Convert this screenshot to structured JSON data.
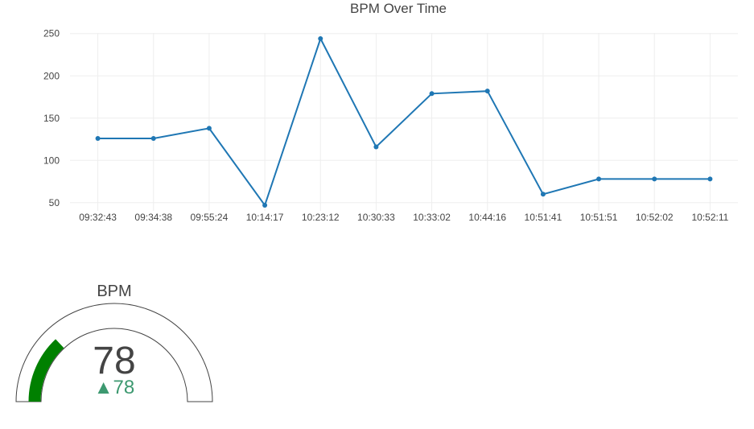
{
  "chart_data": [
    {
      "type": "line",
      "title": "BPM Over Time",
      "xlabel": "",
      "ylabel": "",
      "categories": [
        "09:32:43",
        "09:34:38",
        "09:55:24",
        "10:14:17",
        "10:23:12",
        "10:30:33",
        "10:33:02",
        "10:44:16",
        "10:51:41",
        "10:51:51",
        "10:52:02",
        "10:52:11"
      ],
      "series": [
        {
          "values": [
            126,
            126,
            138,
            47,
            244,
            116,
            179,
            182,
            60,
            78,
            78,
            78
          ]
        }
      ],
      "yticks": [
        50,
        100,
        150,
        200,
        250
      ],
      "ylim": [
        40.3,
        250.7
      ],
      "grid": true,
      "colors": {
        "line": "#1f77b4",
        "grid": "#eeeeee"
      }
    },
    {
      "type": "gauge",
      "title": "BPM",
      "value": 78,
      "delta": "▲78",
      "range": [
        0,
        300
      ],
      "colors": {
        "bar": "#008000",
        "delta": "#3d9970",
        "outline": "#444444"
      }
    }
  ]
}
